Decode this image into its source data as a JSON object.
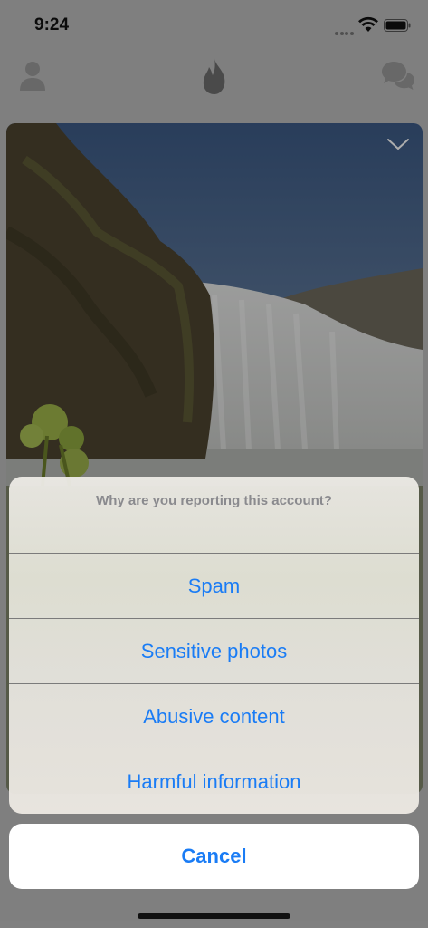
{
  "status_bar": {
    "time": "9:24"
  },
  "header": {
    "icons": [
      "profile-icon",
      "flame-icon",
      "chat-icon"
    ]
  },
  "card": {
    "icons": [
      "chevron-down-icon"
    ]
  },
  "action_sheet": {
    "title": "Why are you reporting this account?",
    "options": [
      {
        "label": "Spam"
      },
      {
        "label": "Sensitive photos"
      },
      {
        "label": "Abusive content"
      },
      {
        "label": "Harmful information"
      }
    ],
    "cancel_label": "Cancel"
  },
  "colors": {
    "accent": "#1a7cf5",
    "title_gray": "#8a8a8e"
  }
}
